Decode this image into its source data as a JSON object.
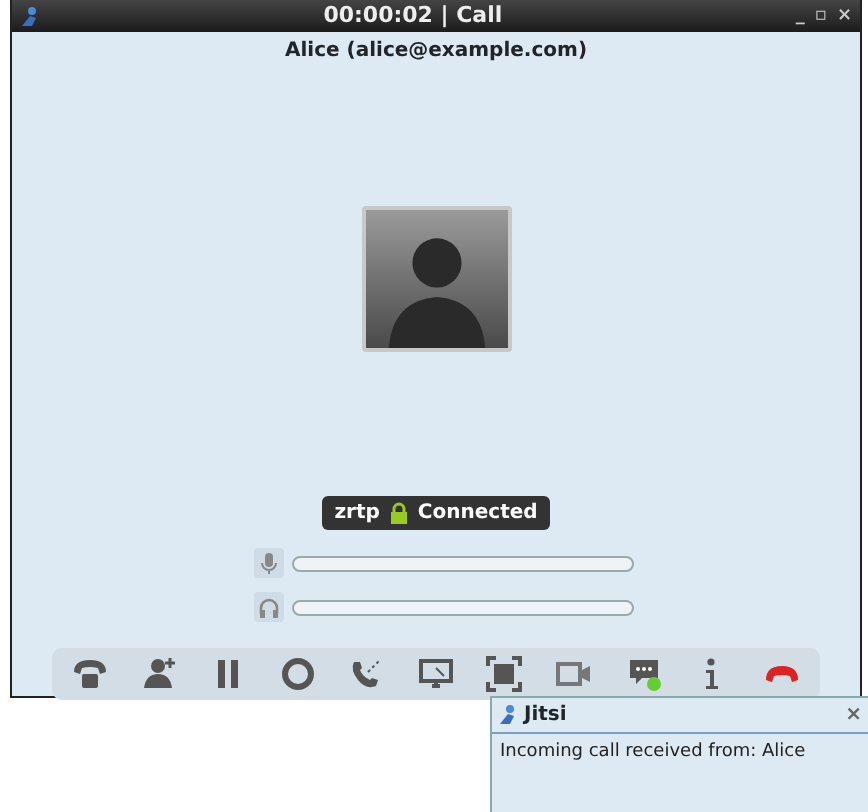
{
  "window": {
    "title": "00:00:02 | Call",
    "controls": [
      "_",
      "▫",
      "×"
    ]
  },
  "peer": {
    "name": "Alice (alice@example.com)"
  },
  "security": {
    "protocol": "zrtp",
    "secured": true,
    "status": "Connected"
  },
  "meters": [
    {
      "kind": "microphone",
      "level": 0
    },
    {
      "kind": "speaker",
      "level": 0
    }
  ],
  "toolbar": [
    {
      "kind": "dialpad"
    },
    {
      "kind": "add-participant"
    },
    {
      "kind": "hold"
    },
    {
      "kind": "record"
    },
    {
      "kind": "transfer"
    },
    {
      "kind": "desktop-share"
    },
    {
      "kind": "fullscreen"
    },
    {
      "kind": "video"
    },
    {
      "kind": "chat"
    },
    {
      "kind": "info"
    },
    {
      "kind": "hangup"
    }
  ],
  "notification": {
    "title": "Jitsi",
    "close": "×",
    "message": "Incoming call received from: Alice"
  }
}
